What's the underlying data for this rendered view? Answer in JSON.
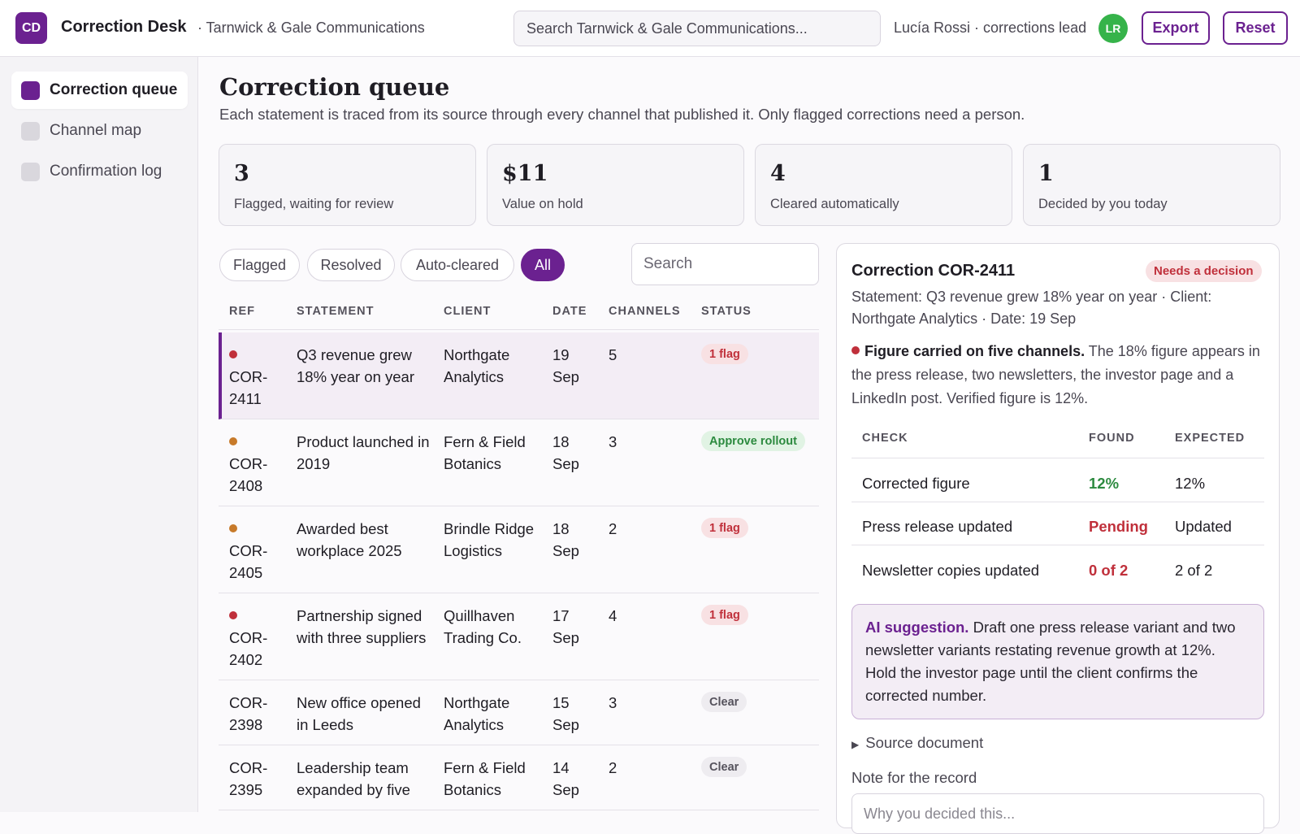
{
  "app": {
    "logo": "CD",
    "title": "Correction Desk",
    "org": "· Tarnwick & Gale Communications",
    "search_placeholder": "Search Tarnwick & Gale Communications...",
    "user": "Lucía Rossi · corrections lead",
    "avatar": "LR",
    "export_label": "Export",
    "reset_label": "Reset"
  },
  "sidebar": {
    "items": [
      {
        "label": "Correction queue",
        "active": true
      },
      {
        "label": "Channel map",
        "active": false
      },
      {
        "label": "Confirmation log",
        "active": false
      }
    ]
  },
  "main": {
    "title": "Correction queue",
    "subtitle": "Each statement is traced from its source through every channel that published it. Only flagged corrections need a person."
  },
  "stats": [
    {
      "value": "3",
      "label": "Flagged, waiting for review"
    },
    {
      "value": "$11",
      "label": "Value on hold"
    },
    {
      "value": "4",
      "label": "Cleared automatically"
    },
    {
      "value": "1",
      "label": "Decided by you today"
    }
  ],
  "filters": {
    "chips": [
      {
        "label": "Flagged",
        "active": false
      },
      {
        "label": "Resolved",
        "active": false
      },
      {
        "label": "Auto-cleared",
        "active": false
      },
      {
        "label": "All",
        "active": true
      }
    ],
    "search_placeholder": "Search"
  },
  "table": {
    "headers": [
      "REF",
      "STATEMENT",
      "CLIENT",
      "DATE",
      "CHANNELS",
      "STATUS"
    ],
    "rows": [
      {
        "ref_a": "COR-",
        "ref_b": "2411",
        "statement": "Q3 revenue grew 18% year on year",
        "client": "Northgate Analytics",
        "date_a": "19",
        "date_b": "Sep",
        "channels": "5",
        "status": "1 flag",
        "kind": "flag",
        "dot": "#c0303b"
      },
      {
        "ref_a": "COR-",
        "ref_b": "2408",
        "statement": "Product launched in 2019",
        "client": "Fern & Field Botanics",
        "date_a": "18",
        "date_b": "Sep",
        "channels": "3",
        "status": "Approve rollout",
        "kind": "approve",
        "dot": "#c77a2a"
      },
      {
        "ref_a": "COR-",
        "ref_b": "2405",
        "statement": "Awarded best workplace 2025",
        "client": "Brindle Ridge Logistics",
        "date_a": "18",
        "date_b": "Sep",
        "channels": "2",
        "status": "1 flag",
        "kind": "flag",
        "dot": "#c77a2a"
      },
      {
        "ref_a": "COR-",
        "ref_b": "2402",
        "statement": "Partnership signed with three suppliers",
        "client": "Quillhaven Trading Co.",
        "date_a": "17",
        "date_b": "Sep",
        "channels": "4",
        "status": "1 flag",
        "kind": "flag",
        "dot": "#c0303b"
      },
      {
        "ref_a": "COR-",
        "ref_b": "2398",
        "statement": "New office opened in Leeds",
        "client": "Northgate Analytics",
        "date_a": "15",
        "date_b": "Sep",
        "channels": "3",
        "status": "Clear",
        "kind": "clear",
        "dot": ""
      },
      {
        "ref_a": "COR-",
        "ref_b": "2395",
        "statement": "Leadership team expanded by five",
        "client": "Fern & Field Botanics",
        "date_a": "14",
        "date_b": "Sep",
        "channels": "2",
        "status": "Clear",
        "kind": "clear",
        "dot": ""
      }
    ]
  },
  "detail": {
    "title": "Correction COR-2411",
    "badge": "Needs a decision",
    "meta": "Statement: Q3 revenue grew 18% year on year · Client: Northgate Analytics · Date: 19 Sep",
    "alert_title": "Figure carried on five channels.",
    "alert_body": "The 18% figure appears in the press release, two newsletters, the investor page and a LinkedIn post. Verified figure is 12%.",
    "check_headers": [
      "CHECK",
      "FOUND",
      "EXPECTED"
    ],
    "checks": [
      {
        "check": "Corrected figure",
        "found": "12%",
        "expected": "12%",
        "ok": true
      },
      {
        "check": "Press release updated",
        "found": "Pending",
        "expected": "Updated",
        "ok": false
      },
      {
        "check": "Newsletter copies updated",
        "found": "0 of 2",
        "expected": "2 of 2",
        "ok": false
      }
    ],
    "ai_label": "AI suggestion.",
    "ai_text": "Draft one press release variant and two newsletter variants restating revenue growth at 12%. Hold the investor page until the client confirms the corrected number.",
    "source_label": "Source document",
    "note_label": "Note for the record",
    "note_placeholder": "Why you decided this..."
  }
}
